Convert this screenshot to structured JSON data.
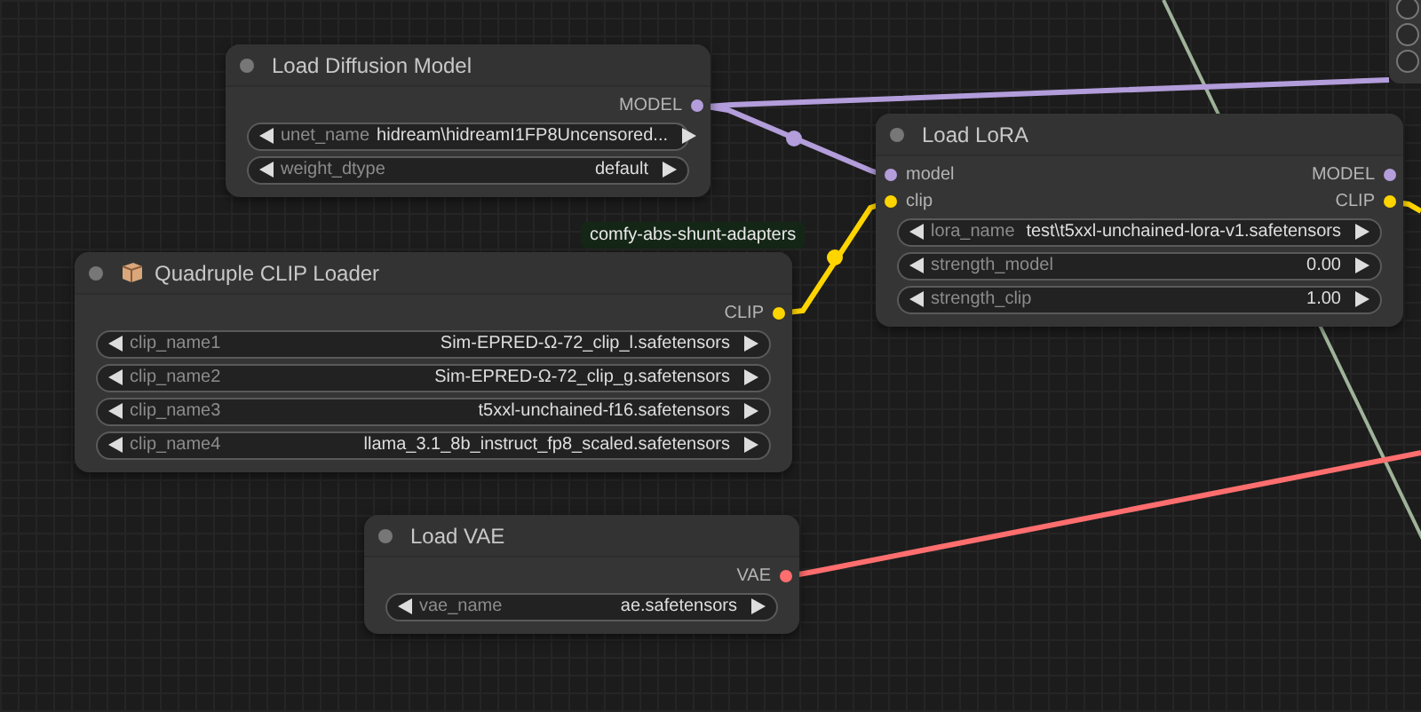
{
  "tag": "comfy-abs-shunt-adapters",
  "nodes": [
    {
      "title": "Load Diffusion Model",
      "icon": false,
      "slots": [
        {
          "output": {
            "label": "MODEL",
            "color": "#b39ddb"
          }
        }
      ],
      "widgets": [
        {
          "name": "unet_name",
          "value": "hidream\\hidreamI1FP8Uncensored..."
        },
        {
          "name": "weight_dtype",
          "value": "default"
        }
      ]
    },
    {
      "title": "Load LoRA",
      "icon": false,
      "slots": [
        {
          "input": {
            "label": "model",
            "color": "#b39ddb"
          },
          "output": {
            "label": "MODEL",
            "color": "#b39ddb"
          }
        },
        {
          "input": {
            "label": "clip",
            "color": "#ffd500"
          },
          "output": {
            "label": "CLIP",
            "color": "#ffd500"
          }
        }
      ],
      "widgets": [
        {
          "name": "lora_name",
          "value": "test\\t5xxl-unchained-lora-v1.safetensors"
        },
        {
          "name": "strength_model",
          "value": "0.00"
        },
        {
          "name": "strength_clip",
          "value": "1.00"
        }
      ]
    },
    {
      "title": "Quadruple CLIP Loader",
      "icon": true,
      "slots": [
        {
          "output": {
            "label": "CLIP",
            "color": "#ffd500"
          }
        }
      ],
      "widgets": [
        {
          "name": "clip_name1",
          "value": "Sim-EPRED-Ω-72_clip_l.safetensors"
        },
        {
          "name": "clip_name2",
          "value": "Sim-EPRED-Ω-72_clip_g.safetensors"
        },
        {
          "name": "clip_name3",
          "value": "t5xxl-unchained-f16.safetensors"
        },
        {
          "name": "clip_name4",
          "value": "llama_3.1_8b_instruct_fp8_scaled.safetensors"
        }
      ]
    },
    {
      "title": "Load VAE",
      "icon": false,
      "slots": [
        {
          "output": {
            "label": "VAE",
            "color": "#ff6e6e"
          }
        }
      ],
      "widgets": [
        {
          "name": "vae_name",
          "value": "ae.safetensors"
        }
      ]
    }
  ]
}
